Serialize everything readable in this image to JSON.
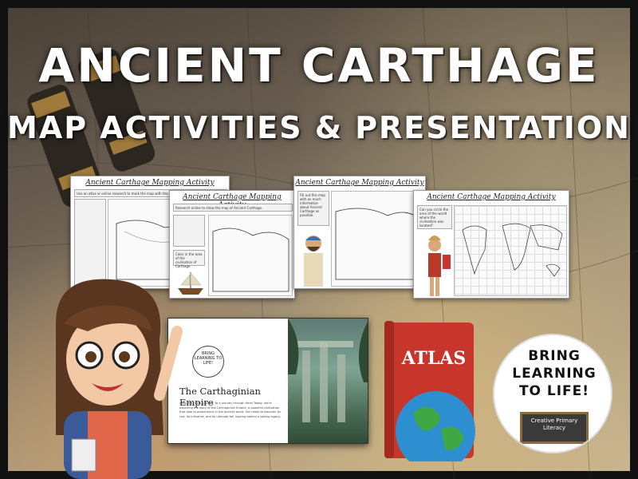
{
  "title": "ANCIENT CARTHAGE",
  "subtitle": "MAP ACTIVITIES & PRESENTATION",
  "cards": [
    {
      "heading": "Ancient Carthage Mapping Activity",
      "box_text": "Use an atlas or online research to mark the map with the following colours:"
    },
    {
      "heading": "Ancient Carthage Mapping Activity",
      "box_text": "Research online to show the map of Ancient Carthage.",
      "box_bottom": "Color in the area of the civilisation of Carthage."
    },
    {
      "heading": "Ancient Carthage Mapping Activity",
      "box_text": "Fill out this map with as much information about Ancient Carthage as possible."
    },
    {
      "heading": "Ancient Carthage Mapping Activity",
      "box_text": "Can you circle the area of the world where the civilisation was located?"
    }
  ],
  "presentation": {
    "title": "The Carthaginian Empire",
    "text": "Welcome, sixth graders, to a journey through time! Today, we're exploring the story of the Carthaginian Empire, a powerful civilisation that rose to prominence in the ancient world. Get ready to discover its rise, its influence, and its ultimate fall, leaving behind a lasting legacy.",
    "logo_text": "BRING LEARNING TO LIFE!"
  },
  "atlas": {
    "label": "ATLAS"
  },
  "brand": {
    "line1": "BRING",
    "line2": "LEARNING",
    "line3": "TO LIFE!",
    "board": "Creative Primary Literacy"
  }
}
